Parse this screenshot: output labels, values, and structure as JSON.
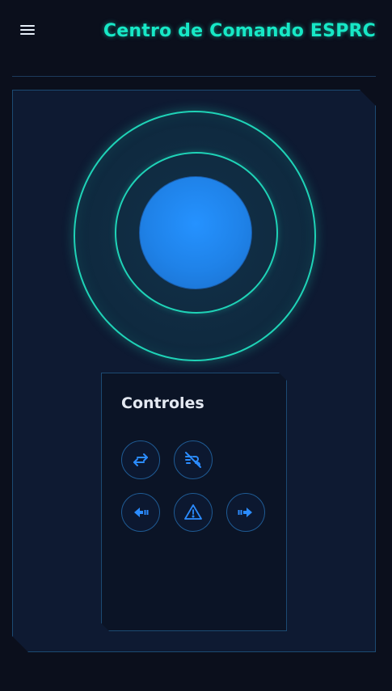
{
  "header": {
    "title": "Centro de Comando ESPRC",
    "menu_icon": "hamburger-menu-icon"
  },
  "joystick": {
    "ring_color": "#1fd3b7",
    "knob_color": "#1f82e8"
  },
  "controls": {
    "title": "Controles",
    "buttons": [
      {
        "icon": "swap-direction-icon"
      },
      {
        "icon": "wind-off-icon"
      },
      {
        "icon": "left-arrow-icon"
      },
      {
        "icon": "warning-triangle-icon"
      },
      {
        "icon": "right-arrow-icon"
      }
    ],
    "icon_color": "#2b8cff"
  },
  "colors": {
    "accent": "#17e8c6",
    "background": "#0b0f1c",
    "panel": "#0e1a32",
    "border": "#1c4a72"
  }
}
